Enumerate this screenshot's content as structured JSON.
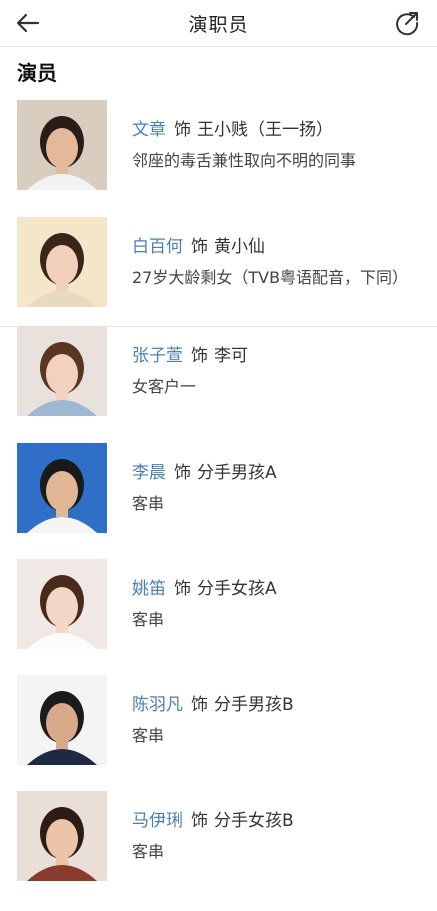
{
  "header": {
    "title": "演职员",
    "back_icon": "arrow-left-icon",
    "share_icon": "share-icon"
  },
  "section": {
    "title": "演员"
  },
  "cast": [
    {
      "actor": "文章",
      "role_prefix": "饰",
      "role": "王小贱（王一扬）",
      "desc": "邻座的毒舌兼性取向不明的同事",
      "photo_bg": "#d9cdbf",
      "skin": "#e4b89b",
      "hair": "#2a1d17",
      "cloth": "#f2f2f2"
    },
    {
      "actor": "白百何",
      "role_prefix": "饰",
      "role": "黄小仙",
      "desc": "27岁大龄剩女（TVB粤语配音，下同）",
      "photo_bg": "#f6e6c9",
      "skin": "#f1d0bd",
      "hair": "#3b2418",
      "cloth": "#e8d9c2"
    },
    {
      "actor": "张子萱",
      "role_prefix": "饰",
      "role": "李可",
      "desc": "女客户一",
      "photo_bg": "#e9e2dc",
      "skin": "#f2d2bf",
      "hair": "#5a3522",
      "cloth": "#9fb8d2"
    },
    {
      "actor": "李晨",
      "role_prefix": "饰",
      "role": "分手男孩A",
      "desc": "客串",
      "photo_bg": "#2f6fc8",
      "skin": "#e2b796",
      "hair": "#1a1a1a",
      "cloth": "#f5f5f5"
    },
    {
      "actor": "姚笛",
      "role_prefix": "饰",
      "role": "分手女孩A",
      "desc": "客串",
      "photo_bg": "#efe8e4",
      "skin": "#f3d6c6",
      "hair": "#4a2a1c",
      "cloth": "#fbfbfb"
    },
    {
      "actor": "陈羽凡",
      "role_prefix": "饰",
      "role": "分手男孩B",
      "desc": "客串",
      "photo_bg": "#f4f4f4",
      "skin": "#d8a98a",
      "hair": "#1b1b1b",
      "cloth": "#1e2a44"
    },
    {
      "actor": "马伊琍",
      "role_prefix": "饰",
      "role": "分手女孩B",
      "desc": "客串",
      "photo_bg": "#eadfd6",
      "skin": "#ecc4aa",
      "hair": "#2c1c15",
      "cloth": "#8a3b2f"
    }
  ]
}
